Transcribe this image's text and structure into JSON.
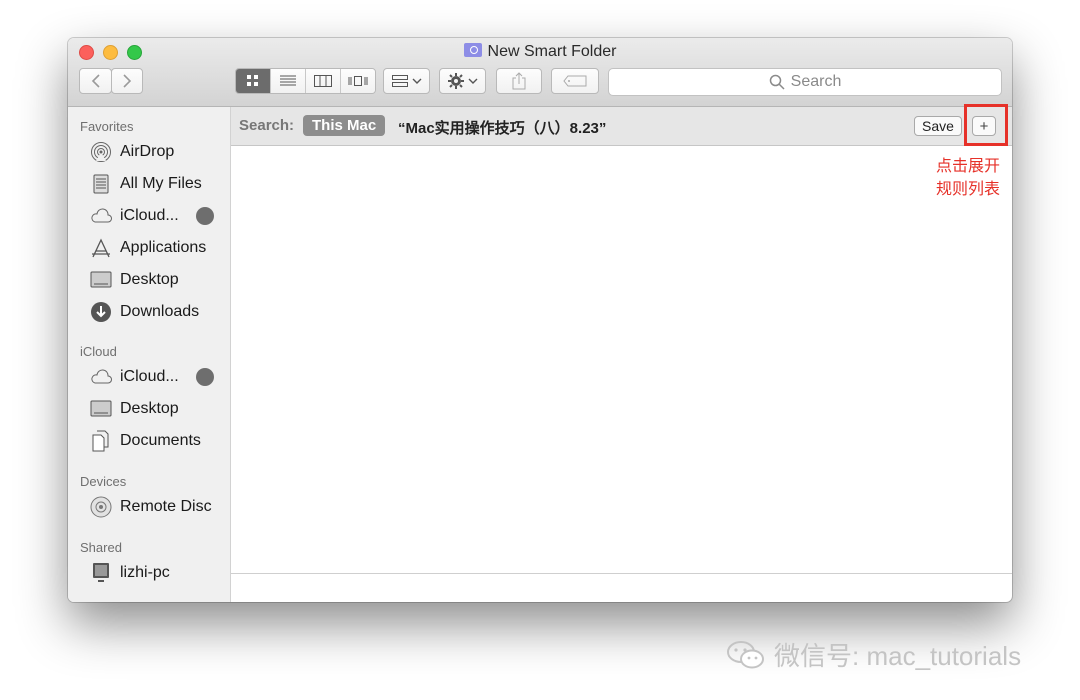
{
  "window": {
    "title": "New Smart Folder"
  },
  "toolbar": {
    "search_placeholder": "Search"
  },
  "sidebar": {
    "sections": {
      "favorites": "Favorites",
      "icloud": "iCloud",
      "devices": "Devices",
      "shared": "Shared"
    },
    "favorites": [
      "AirDrop",
      "All My Files",
      "iCloud...",
      "Applications",
      "Desktop",
      "Downloads"
    ],
    "icloud_items": [
      "iCloud...",
      "Desktop",
      "Documents"
    ],
    "devices": [
      "Remote Disc"
    ],
    "shared": [
      "lizhi-pc"
    ]
  },
  "searchbar": {
    "label": "Search:",
    "scope": "This Mac",
    "query": "“Mac实用操作技巧（八）8.23”",
    "save_label": "Save",
    "add_rule": "+"
  },
  "annotation": {
    "line1": "点击展开",
    "line2": "规则列表"
  },
  "watermark": "微信号: mac_tutorials",
  "colors": {
    "annotation_red": "#e63129",
    "scope_badge": "#8d8d8d"
  },
  "icons": [
    "chevron-left-icon",
    "chevron-right-icon",
    "icon-view-icon",
    "list-view-icon",
    "column-view-icon",
    "coverflow-view-icon",
    "arrange-icon",
    "gear-icon",
    "share-icon",
    "tag-icon",
    "search-icon",
    "airdrop-icon",
    "all-files-icon",
    "cloud-icon",
    "applications-icon",
    "desktop-icon",
    "downloads-icon",
    "documents-icon",
    "disc-icon",
    "computer-icon",
    "wechat-icon"
  ]
}
